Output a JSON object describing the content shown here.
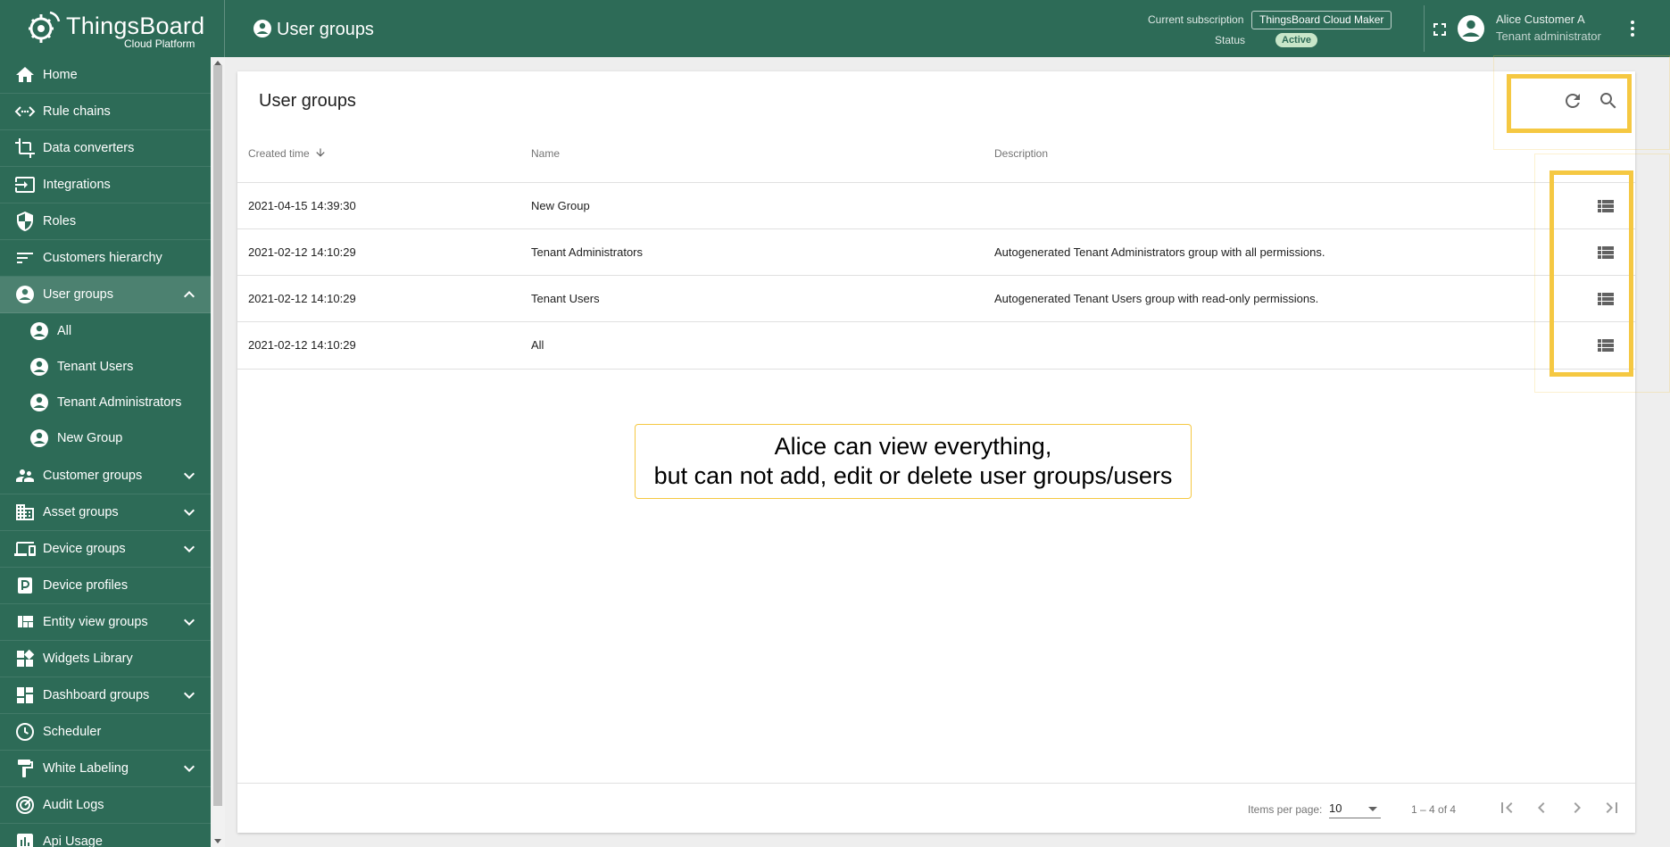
{
  "app": {
    "logo_name": "ThingsBoard",
    "logo_sub": "Cloud Platform"
  },
  "header": {
    "page_title": "User groups",
    "subscription_label": "Current subscription",
    "subscription_value": "ThingsBoard Cloud Maker",
    "status_label": "Status",
    "status_value": "Active",
    "user_name": "Alice Customer A",
    "user_role": "Tenant administrator"
  },
  "sidebar": {
    "items": [
      {
        "label": "Home",
        "icon": "home-icon"
      },
      {
        "label": "Rule chains",
        "icon": "rule-chain-icon"
      },
      {
        "label": "Data converters",
        "icon": "crop-icon"
      },
      {
        "label": "Integrations",
        "icon": "input-icon"
      },
      {
        "label": "Roles",
        "icon": "shield-icon"
      },
      {
        "label": "Customers hierarchy",
        "icon": "sort-icon"
      },
      {
        "label": "User groups",
        "icon": "account-circle-icon"
      },
      {
        "label": "Customer groups",
        "icon": "supervisor-icon"
      },
      {
        "label": "Asset groups",
        "icon": "domain-icon"
      },
      {
        "label": "Device groups",
        "icon": "devices-icon"
      },
      {
        "label": "Device profiles",
        "icon": "device-profile-icon"
      },
      {
        "label": "Entity view groups",
        "icon": "view-quilt-icon"
      },
      {
        "label": "Widgets Library",
        "icon": "widgets-icon"
      },
      {
        "label": "Dashboard groups",
        "icon": "dashboard-icon"
      },
      {
        "label": "Scheduler",
        "icon": "schedule-icon"
      },
      {
        "label": "White Labeling",
        "icon": "format-paint-icon"
      },
      {
        "label": "Audit Logs",
        "icon": "track-changes-icon"
      },
      {
        "label": "Api Usage",
        "icon": "insert-chart-icon"
      }
    ],
    "sub_items": [
      {
        "label": "All"
      },
      {
        "label": "Tenant Users"
      },
      {
        "label": "Tenant Administrators"
      },
      {
        "label": "New Group"
      }
    ]
  },
  "card": {
    "title": "User groups",
    "columns": {
      "created_time": "Created time",
      "name": "Name",
      "description": "Description"
    },
    "rows": [
      {
        "created": "2021-04-15 14:39:30",
        "name": "New Group",
        "description": ""
      },
      {
        "created": "2021-02-12 14:10:29",
        "name": "Tenant Administrators",
        "description": "Autogenerated Tenant Administrators group with all permissions."
      },
      {
        "created": "2021-02-12 14:10:29",
        "name": "Tenant Users",
        "description": "Autogenerated Tenant Users group with read-only permissions."
      },
      {
        "created": "2021-02-12 14:10:29",
        "name": "All",
        "description": ""
      }
    ],
    "footer": {
      "items_per_page_label": "Items per page:",
      "items_per_page_value": "10",
      "range": "1 – 4 of 4"
    }
  },
  "callout": {
    "line1": "Alice can view everything,",
    "line2": "but can not add, edit or delete user groups/users"
  },
  "colors": {
    "primary": "#2d6b57",
    "highlight": "#f5c842"
  }
}
